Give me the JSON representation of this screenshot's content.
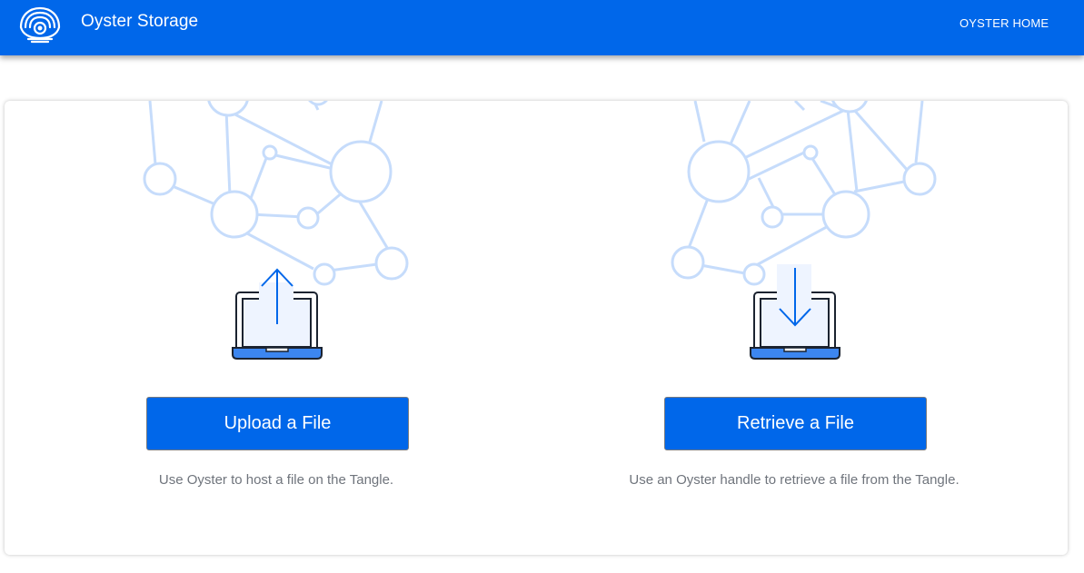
{
  "header": {
    "app_title": "Oyster Storage",
    "nav_link": "OYSTER HOME",
    "logo_icon": "oyster-logo-icon"
  },
  "colors": {
    "primary": "#0067ea",
    "network": "#c6dcfb",
    "muted_text": "#6f747c",
    "laptop_screen": "#eef4ff"
  },
  "upload": {
    "icon": "laptop-upload-icon",
    "button_label": "Upload a File",
    "description": "Use Oyster to host a file on the Tangle."
  },
  "retrieve": {
    "icon": "laptop-download-icon",
    "button_label": "Retrieve a File",
    "description": "Use an Oyster handle to retrieve a file from the Tangle."
  }
}
